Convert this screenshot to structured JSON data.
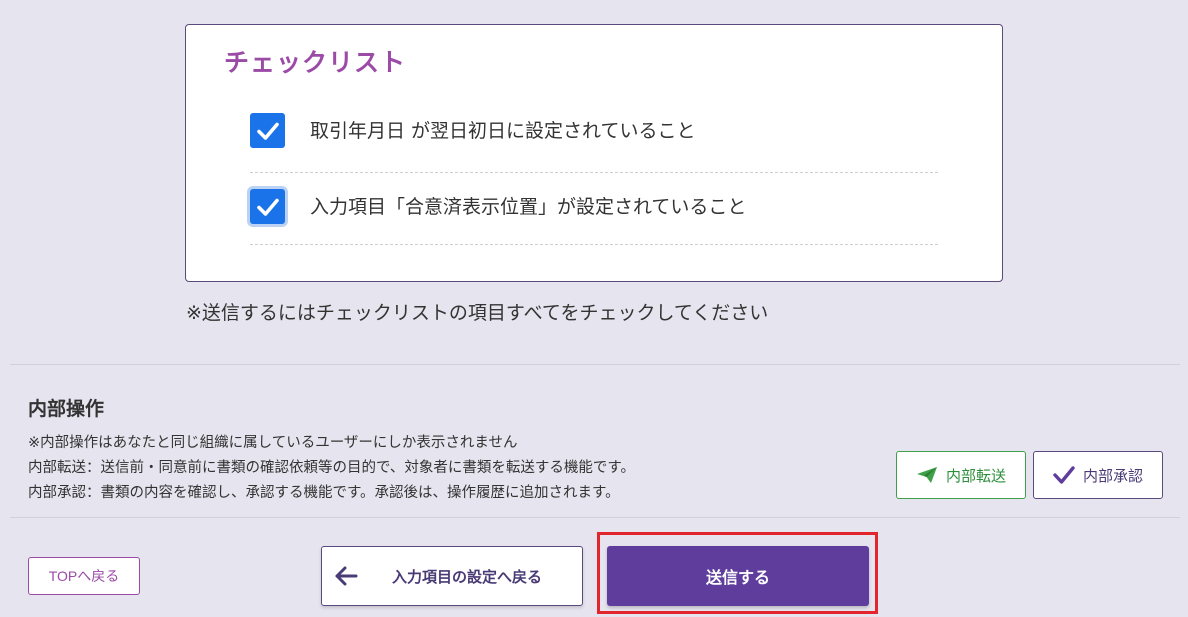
{
  "checklist": {
    "title": "チェックリスト",
    "items": [
      {
        "label": "取引年月日 が翌日初日に設定されていること",
        "checked": true
      },
      {
        "label": "入力項目「合意済表示位置」が設定されていること",
        "checked": true
      }
    ],
    "note": "※送信するにはチェックリストの項目すべてをチェックしてください"
  },
  "internal": {
    "title": "内部操作",
    "lines": [
      "※内部操作はあなたと同じ組織に属しているユーザーにしか表示されません",
      "内部転送：送信前・同意前に書類の確認依頼等の目的で、対象者に書類を転送する機能です。",
      "内部承認：書類の内容を確認し、承認する機能です。承認後は、操作履歴に追加されます。"
    ],
    "forward_label": "内部転送",
    "approve_label": "内部承認"
  },
  "footer": {
    "top_label": "TOPへ戻る",
    "back_label": "入力項目の設定へ戻る",
    "send_label": "送信する"
  },
  "colors": {
    "accent": "#5e3d9c",
    "title": "#9b4aa6",
    "checkbox": "#1a73e8",
    "forward": "#3ea048",
    "highlight": "#e3262e"
  }
}
